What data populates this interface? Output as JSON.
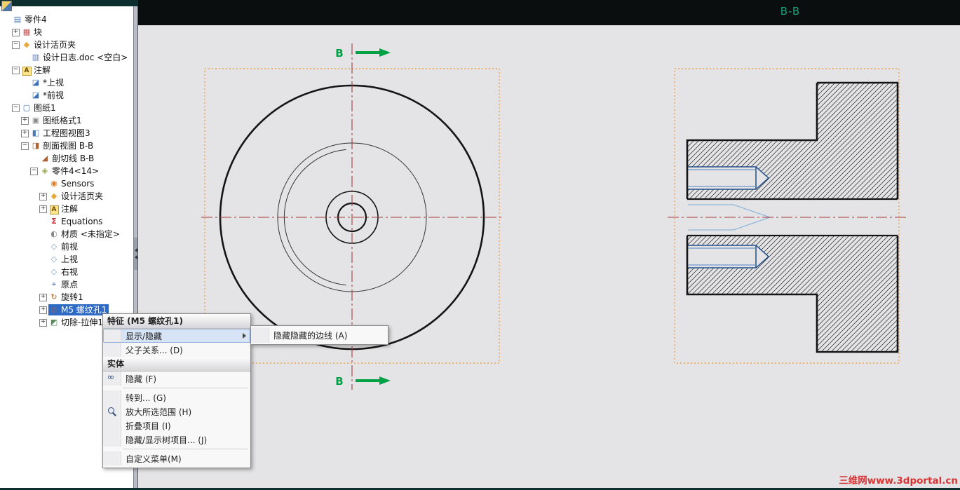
{
  "colors": {
    "selection": "#2f6bc4",
    "section-green": "#00a045",
    "centerline-red": "#a33c3c",
    "box-orange": "#f2a24e",
    "watermark-red": "#d63434",
    "bb-label": "#17a07b",
    "thread-blue": "#1f4e8c",
    "thread-light-blue": "#8fb6d9"
  },
  "drawing": {
    "view_label": "B-B",
    "section_marker": "B",
    "watermark": "三维网www.3dportal.cn"
  },
  "tree": {
    "items": [
      {
        "name": "part4-root",
        "label": "零件4",
        "level": 0,
        "icon": "drawing-doc",
        "expand": ""
      },
      {
        "name": "block",
        "label": "块",
        "level": 1,
        "icon": "block",
        "expand": "+"
      },
      {
        "name": "design-binder",
        "label": "设计活页夹",
        "level": 1,
        "icon": "binder",
        "expand": "-"
      },
      {
        "name": "design-journal",
        "label": "设计日志.doc <空白>",
        "level": 2,
        "icon": "doc",
        "expand": ""
      },
      {
        "name": "annotations",
        "label": "注解",
        "level": 1,
        "icon": "annotations",
        "expand": "-"
      },
      {
        "name": "top-view-orient",
        "label": "*上视",
        "level": 2,
        "icon": "view-orient",
        "expand": ""
      },
      {
        "name": "front-view-orient",
        "label": "*前视",
        "level": 2,
        "icon": "view-orient",
        "expand": ""
      },
      {
        "name": "sheet1",
        "label": "图纸1",
        "level": 1,
        "icon": "sheet",
        "expand": "-"
      },
      {
        "name": "sheet-format1",
        "label": "图纸格式1",
        "level": 2,
        "icon": "sheet-format",
        "expand": "+"
      },
      {
        "name": "drawing-view3",
        "label": "工程图视图3",
        "level": 2,
        "icon": "drawing-view",
        "expand": "+"
      },
      {
        "name": "section-view-bb",
        "label": "剖面视图 B-B",
        "level": 2,
        "icon": "section-view",
        "expand": "-"
      },
      {
        "name": "section-line-bb",
        "label": "剖切线 B-B",
        "level": 3,
        "icon": "section-line",
        "expand": ""
      },
      {
        "name": "part4-14",
        "label": "零件4<14>",
        "level": 3,
        "icon": "part-ref",
        "expand": "-"
      },
      {
        "name": "sensors",
        "label": "Sensors",
        "level": 4,
        "icon": "sensors",
        "expand": ""
      },
      {
        "name": "design-binder-2",
        "label": "设计活页夹",
        "level": 4,
        "icon": "binder",
        "expand": "+"
      },
      {
        "name": "annotations-2",
        "label": "注解",
        "level": 4,
        "icon": "annotations",
        "expand": "+"
      },
      {
        "name": "equations",
        "label": "Equations",
        "level": 4,
        "icon": "equations",
        "expand": ""
      },
      {
        "name": "material",
        "label": "材质 <未指定>",
        "level": 4,
        "icon": "material",
        "expand": ""
      },
      {
        "name": "front-plane",
        "label": "前视",
        "level": 4,
        "icon": "plane",
        "expand": ""
      },
      {
        "name": "top-plane",
        "label": "上视",
        "level": 4,
        "icon": "plane",
        "expand": ""
      },
      {
        "name": "right-plane",
        "label": "右视",
        "level": 4,
        "icon": "plane",
        "expand": ""
      },
      {
        "name": "origin",
        "label": "原点",
        "level": 4,
        "icon": "origin",
        "expand": ""
      },
      {
        "name": "revolve1",
        "label": "旋转1",
        "level": 4,
        "icon": "revolve",
        "expand": "+"
      },
      {
        "name": "m5-tapped-hole1",
        "label": "M5 螺纹孔1",
        "level": 4,
        "icon": "hole-wizard",
        "expand": "+",
        "selected": true
      },
      {
        "name": "cut-extrude1",
        "label": "切除-拉伸1",
        "level": 4,
        "icon": "cut-extrude",
        "expand": "+"
      }
    ]
  },
  "context_menu": {
    "header": "特征 (M5 螺纹孔1)",
    "items": [
      {
        "type": "item",
        "name": "show-hide",
        "label": "显示/隐藏",
        "submenu": true,
        "highlighted": true
      },
      {
        "type": "item",
        "name": "parent-child",
        "label": "父子关系... (D)"
      },
      {
        "type": "header",
        "name": "solid-header",
        "label": "实体"
      },
      {
        "type": "item",
        "name": "hide",
        "label": "隐藏 (F)",
        "icon": "glasses"
      },
      {
        "type": "separator"
      },
      {
        "type": "item",
        "name": "go-to",
        "label": "转到... (G)"
      },
      {
        "type": "item",
        "name": "zoom-to-selection",
        "label": "放大所选范围 (H)",
        "icon": "magnify"
      },
      {
        "type": "item",
        "name": "collapse-items",
        "label": "折叠项目 (I)"
      },
      {
        "type": "item",
        "name": "hide-show-tree-items",
        "label": "隐藏/显示树项目... (J)"
      },
      {
        "type": "separator"
      },
      {
        "type": "item",
        "name": "customize-menu",
        "label": "自定义菜单(M)"
      }
    ],
    "submenu_items": [
      {
        "name": "hide-hidden-edges",
        "label": "隐藏隐藏的边线 (A)"
      }
    ]
  }
}
